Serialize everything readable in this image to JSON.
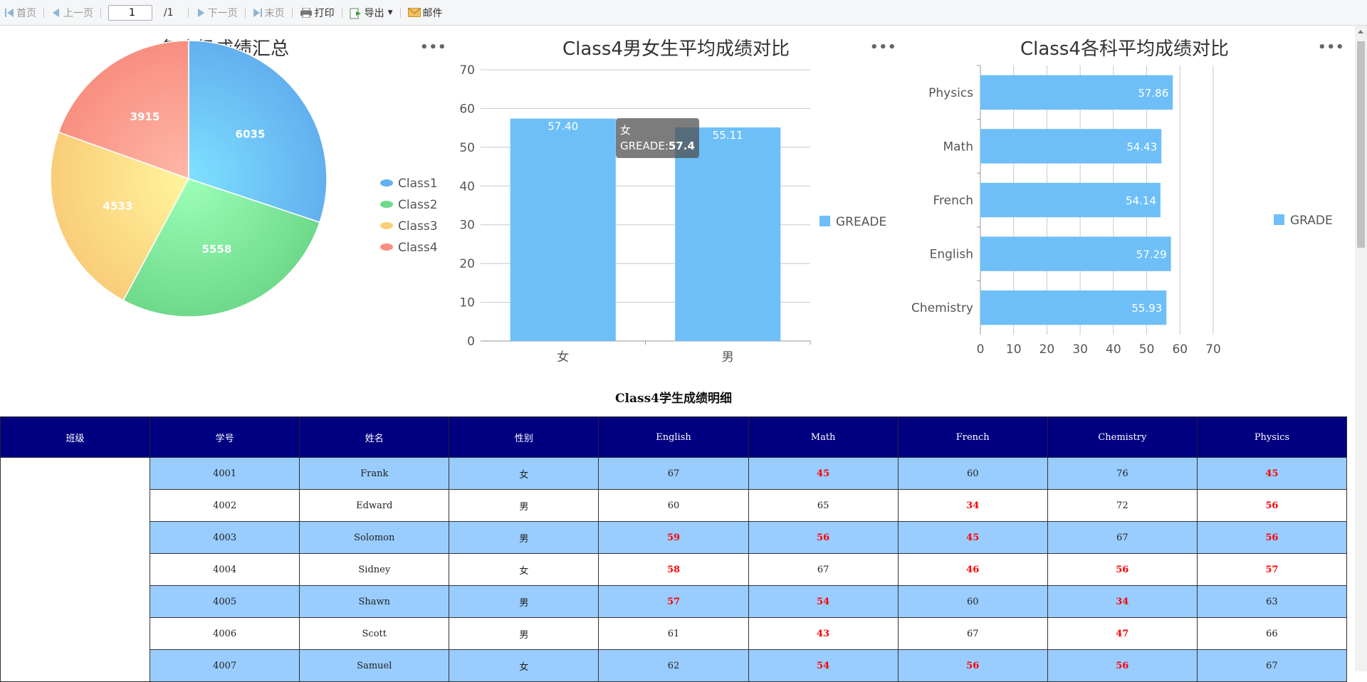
{
  "toolbar": {
    "first": "首页",
    "prev": "上一页",
    "page_value": "1",
    "page_total": "/1",
    "next": "下一页",
    "last": "末页",
    "print": "打印",
    "export": "导出",
    "mail": "邮件"
  },
  "charts": {
    "pie_title": "各班级成绩汇总",
    "bar_title": "Class4男女生平均成绩对比",
    "hbar_title": "Class4各科平均成绩对比",
    "more": "•••"
  },
  "chart_data": [
    {
      "type": "pie",
      "title": "各班级成绩汇总",
      "categories": [
        "Class1",
        "Class2",
        "Class3",
        "Class4"
      ],
      "values": [
        6035,
        5558,
        4533,
        3915
      ],
      "colors": [
        "#62b0ef",
        "#6ed98b",
        "#f9cd79",
        "#f88f80"
      ],
      "legend": "right"
    },
    {
      "type": "bar",
      "title": "Class4男女生平均成绩对比",
      "categories": [
        "女",
        "男"
      ],
      "series": [
        {
          "name": "GREADE",
          "values": [
            57.4,
            55.11
          ]
        }
      ],
      "value_labels": [
        "57.40",
        "55.11"
      ],
      "ylim": [
        0,
        70
      ],
      "yticks": [
        0,
        10,
        20,
        30,
        40,
        50,
        60,
        70
      ],
      "grid": true,
      "legend": "right",
      "color": "#6ebff8",
      "tooltip": {
        "category": "女",
        "series": "GREADE:",
        "value": "57.4"
      }
    },
    {
      "type": "bar",
      "orientation": "horizontal",
      "title": "Class4各科平均成绩对比",
      "categories": [
        "Physics",
        "Math",
        "French",
        "English",
        "Chemistry"
      ],
      "series": [
        {
          "name": "GRADE",
          "values": [
            57.86,
            54.43,
            54.14,
            57.29,
            55.93
          ]
        }
      ],
      "value_labels": [
        "57.86",
        "54.43",
        "54.14",
        "57.29",
        "55.93"
      ],
      "xlim": [
        0,
        70
      ],
      "xticks": [
        0,
        10,
        20,
        30,
        40,
        50,
        60,
        70
      ],
      "grid": true,
      "legend": "right",
      "color": "#6ebff8"
    }
  ],
  "table": {
    "title": "Class4学生成绩明细",
    "headers": [
      "班级",
      "学号",
      "姓名",
      "性别",
      "English",
      "Math",
      "French",
      "Chemistry",
      "Physics"
    ],
    "rows": [
      [
        "4001",
        "Frank",
        "女",
        "67",
        "45",
        "60",
        "76",
        "45"
      ],
      [
        "4002",
        "Edward",
        "男",
        "60",
        "65",
        "34",
        "72",
        "56"
      ],
      [
        "4003",
        "Solomon",
        "男",
        "59",
        "56",
        "45",
        "67",
        "56"
      ],
      [
        "4004",
        "Sidney",
        "女",
        "58",
        "67",
        "46",
        "56",
        "57"
      ],
      [
        "4005",
        "Shawn",
        "男",
        "57",
        "54",
        "60",
        "34",
        "63"
      ],
      [
        "4006",
        "Scott",
        "男",
        "61",
        "43",
        "67",
        "47",
        "66"
      ],
      [
        "4007",
        "Samuel",
        "女",
        "62",
        "54",
        "56",
        "56",
        "67"
      ]
    ],
    "low_color": "#ff0000"
  }
}
